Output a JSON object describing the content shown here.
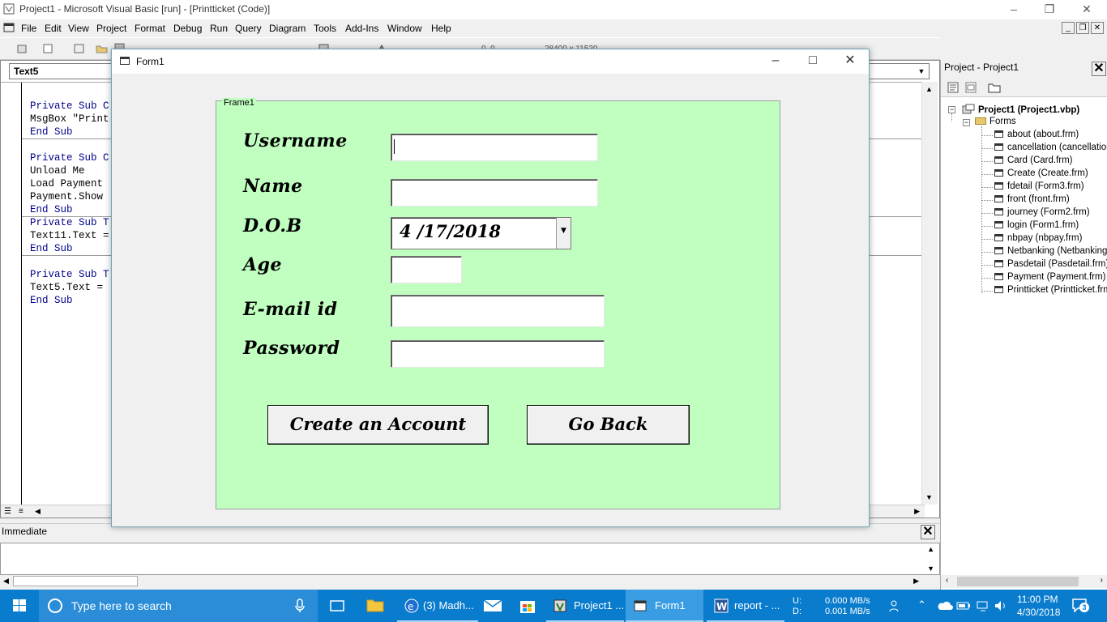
{
  "ide": {
    "title": "Project1 - Microsoft Visual Basic [run] - [Printticket (Code)]",
    "menu": [
      "File",
      "Edit",
      "View",
      "Project",
      "Format",
      "Debug",
      "Run",
      "Query",
      "Diagram",
      "Tools",
      "Add-Ins",
      "Window",
      "Help"
    ],
    "toolbar_coords_a": "0, 0",
    "toolbar_coords_b": "28400 x 11520"
  },
  "code": {
    "object_combo": "Text5",
    "lines": [
      "Private Sub C",
      "MsgBox \"Print",
      "End Sub",
      "Private Sub C",
      "Unload Me",
      "Load Payment",
      "Payment.Show",
      "End Sub",
      "Private Sub T",
      "Text11.Text =",
      "End Sub",
      "Private Sub T",
      "Text5.Text =",
      "End Sub"
    ]
  },
  "immediate": {
    "title": "Immediate"
  },
  "project": {
    "title": "Project - Project1",
    "root": "Project1 (Project1.vbp)",
    "folder": "Forms",
    "forms": [
      "about (about.frm)",
      "cancellation (cancellation.",
      "Card (Card.frm)",
      "Create (Create.frm)",
      "fdetail (Form3.frm)",
      "front (front.frm)",
      "journey (Form2.frm)",
      "login (Form1.frm)",
      "nbpay (nbpay.frm)",
      "Netbanking (Netbanking.f",
      "Pasdetail (Pasdetail.frm)",
      "Payment (Payment.frm)",
      "Printticket (Printticket.frm"
    ]
  },
  "form1": {
    "title": "Form1",
    "frame_caption": "Frame1",
    "labels": {
      "username": "Username",
      "name": "Name",
      "dob": "D.O.B",
      "age": "Age",
      "email": "E-mail id",
      "password": "Password"
    },
    "values": {
      "username": "",
      "name": "",
      "dob": "4 /17/2018",
      "age": "",
      "email": "",
      "password": ""
    },
    "buttons": {
      "create": "Create an  Account",
      "back": "Go Back"
    }
  },
  "taskbar": {
    "search_placeholder": "Type here to search",
    "tasks": [
      "(3) Madh...",
      "Project1 ...",
      "Form1",
      "report - ..."
    ],
    "net_u_label": "U:",
    "net_d_label": "D:",
    "net_u": "0.000 MB/s",
    "net_d": "0.001 MB/s",
    "time": "11:00 PM",
    "date": "4/30/2018",
    "notifications": "3"
  },
  "colors": {
    "frame_bg": "#c0ffc0",
    "taskbar": "#0a7ccd"
  }
}
